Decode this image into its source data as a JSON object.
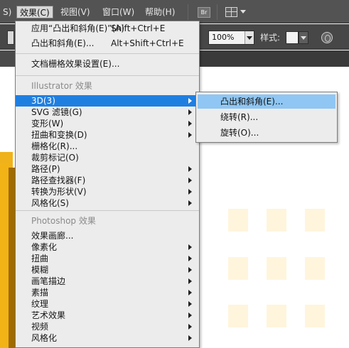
{
  "menubar": {
    "items": [
      "S)",
      "效果(C)",
      "视图(V)",
      "窗口(W)",
      "帮助(H)"
    ],
    "active_item": "效果(C)",
    "badge": "Br"
  },
  "controlbar": {
    "zoom_value": "100%",
    "style_label": "样式:"
  },
  "dropdown": {
    "items": [
      {
        "label": "应用“凸出和斜角(E)”(A)",
        "shortcut": "Shift+Ctrl+E"
      },
      {
        "label": "凸出和斜角(E)...",
        "shortcut": "Alt+Shift+Ctrl+E"
      },
      {
        "label": "文档栅格效果设置(E)..."
      },
      {
        "label": "3D(3)",
        "has_submenu": true,
        "highlighted": true
      },
      {
        "label": "SVG 滤镜(G)",
        "has_submenu": true
      },
      {
        "label": "变形(W)",
        "has_submenu": true
      },
      {
        "label": "扭曲和变换(D)",
        "has_submenu": true
      },
      {
        "label": "栅格化(R)..."
      },
      {
        "label": "裁剪标记(O)"
      },
      {
        "label": "路径(P)",
        "has_submenu": true
      },
      {
        "label": "路径查找器(F)",
        "has_submenu": true
      },
      {
        "label": "转换为形状(V)",
        "has_submenu": true
      },
      {
        "label": "风格化(S)",
        "has_submenu": true
      },
      {
        "label": "效果画廊..."
      },
      {
        "label": "像素化",
        "has_submenu": true
      },
      {
        "label": "扭曲",
        "has_submenu": true
      },
      {
        "label": "模糊",
        "has_submenu": true
      },
      {
        "label": "画笔描边",
        "has_submenu": true
      },
      {
        "label": "素描",
        "has_submenu": true
      },
      {
        "label": "纹理",
        "has_submenu": true
      },
      {
        "label": "艺术效果",
        "has_submenu": true
      },
      {
        "label": "视频",
        "has_submenu": true
      },
      {
        "label": "风格化",
        "has_submenu": true
      }
    ],
    "section_illustrator": "Illustrator 效果",
    "section_photoshop": "Photoshop 效果"
  },
  "submenu": {
    "items": [
      "凸出和斜角(E)...",
      "绕转(R)...",
      "旋转(O)..."
    ],
    "highlighted_index": 0
  },
  "colors": {
    "menu_highlight": "#1f7fe1",
    "submenu_highlight": "#8fc6f3",
    "artwork_orange": "#f2b316",
    "artwork_tile": "#fff5dc"
  }
}
